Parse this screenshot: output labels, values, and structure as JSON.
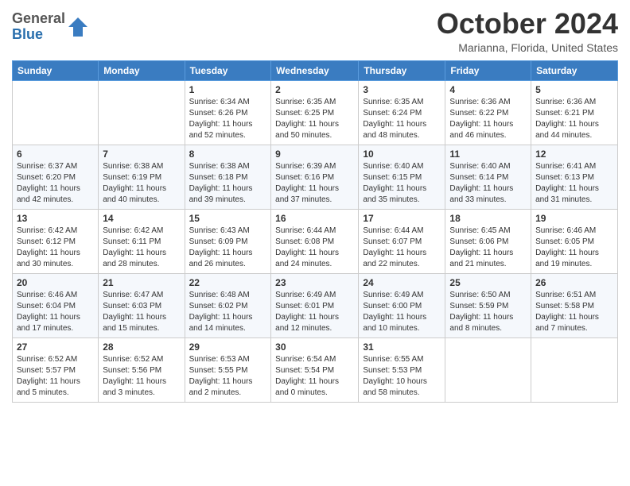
{
  "header": {
    "logo_general": "General",
    "logo_blue": "Blue",
    "month": "October 2024",
    "location": "Marianna, Florida, United States"
  },
  "weekdays": [
    "Sunday",
    "Monday",
    "Tuesday",
    "Wednesday",
    "Thursday",
    "Friday",
    "Saturday"
  ],
  "weeks": [
    [
      {
        "day": "",
        "details": ""
      },
      {
        "day": "",
        "details": ""
      },
      {
        "day": "1",
        "details": "Sunrise: 6:34 AM\nSunset: 6:26 PM\nDaylight: 11 hours and 52 minutes."
      },
      {
        "day": "2",
        "details": "Sunrise: 6:35 AM\nSunset: 6:25 PM\nDaylight: 11 hours and 50 minutes."
      },
      {
        "day": "3",
        "details": "Sunrise: 6:35 AM\nSunset: 6:24 PM\nDaylight: 11 hours and 48 minutes."
      },
      {
        "day": "4",
        "details": "Sunrise: 6:36 AM\nSunset: 6:22 PM\nDaylight: 11 hours and 46 minutes."
      },
      {
        "day": "5",
        "details": "Sunrise: 6:36 AM\nSunset: 6:21 PM\nDaylight: 11 hours and 44 minutes."
      }
    ],
    [
      {
        "day": "6",
        "details": "Sunrise: 6:37 AM\nSunset: 6:20 PM\nDaylight: 11 hours and 42 minutes."
      },
      {
        "day": "7",
        "details": "Sunrise: 6:38 AM\nSunset: 6:19 PM\nDaylight: 11 hours and 40 minutes."
      },
      {
        "day": "8",
        "details": "Sunrise: 6:38 AM\nSunset: 6:18 PM\nDaylight: 11 hours and 39 minutes."
      },
      {
        "day": "9",
        "details": "Sunrise: 6:39 AM\nSunset: 6:16 PM\nDaylight: 11 hours and 37 minutes."
      },
      {
        "day": "10",
        "details": "Sunrise: 6:40 AM\nSunset: 6:15 PM\nDaylight: 11 hours and 35 minutes."
      },
      {
        "day": "11",
        "details": "Sunrise: 6:40 AM\nSunset: 6:14 PM\nDaylight: 11 hours and 33 minutes."
      },
      {
        "day": "12",
        "details": "Sunrise: 6:41 AM\nSunset: 6:13 PM\nDaylight: 11 hours and 31 minutes."
      }
    ],
    [
      {
        "day": "13",
        "details": "Sunrise: 6:42 AM\nSunset: 6:12 PM\nDaylight: 11 hours and 30 minutes."
      },
      {
        "day": "14",
        "details": "Sunrise: 6:42 AM\nSunset: 6:11 PM\nDaylight: 11 hours and 28 minutes."
      },
      {
        "day": "15",
        "details": "Sunrise: 6:43 AM\nSunset: 6:09 PM\nDaylight: 11 hours and 26 minutes."
      },
      {
        "day": "16",
        "details": "Sunrise: 6:44 AM\nSunset: 6:08 PM\nDaylight: 11 hours and 24 minutes."
      },
      {
        "day": "17",
        "details": "Sunrise: 6:44 AM\nSunset: 6:07 PM\nDaylight: 11 hours and 22 minutes."
      },
      {
        "day": "18",
        "details": "Sunrise: 6:45 AM\nSunset: 6:06 PM\nDaylight: 11 hours and 21 minutes."
      },
      {
        "day": "19",
        "details": "Sunrise: 6:46 AM\nSunset: 6:05 PM\nDaylight: 11 hours and 19 minutes."
      }
    ],
    [
      {
        "day": "20",
        "details": "Sunrise: 6:46 AM\nSunset: 6:04 PM\nDaylight: 11 hours and 17 minutes."
      },
      {
        "day": "21",
        "details": "Sunrise: 6:47 AM\nSunset: 6:03 PM\nDaylight: 11 hours and 15 minutes."
      },
      {
        "day": "22",
        "details": "Sunrise: 6:48 AM\nSunset: 6:02 PM\nDaylight: 11 hours and 14 minutes."
      },
      {
        "day": "23",
        "details": "Sunrise: 6:49 AM\nSunset: 6:01 PM\nDaylight: 11 hours and 12 minutes."
      },
      {
        "day": "24",
        "details": "Sunrise: 6:49 AM\nSunset: 6:00 PM\nDaylight: 11 hours and 10 minutes."
      },
      {
        "day": "25",
        "details": "Sunrise: 6:50 AM\nSunset: 5:59 PM\nDaylight: 11 hours and 8 minutes."
      },
      {
        "day": "26",
        "details": "Sunrise: 6:51 AM\nSunset: 5:58 PM\nDaylight: 11 hours and 7 minutes."
      }
    ],
    [
      {
        "day": "27",
        "details": "Sunrise: 6:52 AM\nSunset: 5:57 PM\nDaylight: 11 hours and 5 minutes."
      },
      {
        "day": "28",
        "details": "Sunrise: 6:52 AM\nSunset: 5:56 PM\nDaylight: 11 hours and 3 minutes."
      },
      {
        "day": "29",
        "details": "Sunrise: 6:53 AM\nSunset: 5:55 PM\nDaylight: 11 hours and 2 minutes."
      },
      {
        "day": "30",
        "details": "Sunrise: 6:54 AM\nSunset: 5:54 PM\nDaylight: 11 hours and 0 minutes."
      },
      {
        "day": "31",
        "details": "Sunrise: 6:55 AM\nSunset: 5:53 PM\nDaylight: 10 hours and 58 minutes."
      },
      {
        "day": "",
        "details": ""
      },
      {
        "day": "",
        "details": ""
      }
    ]
  ]
}
